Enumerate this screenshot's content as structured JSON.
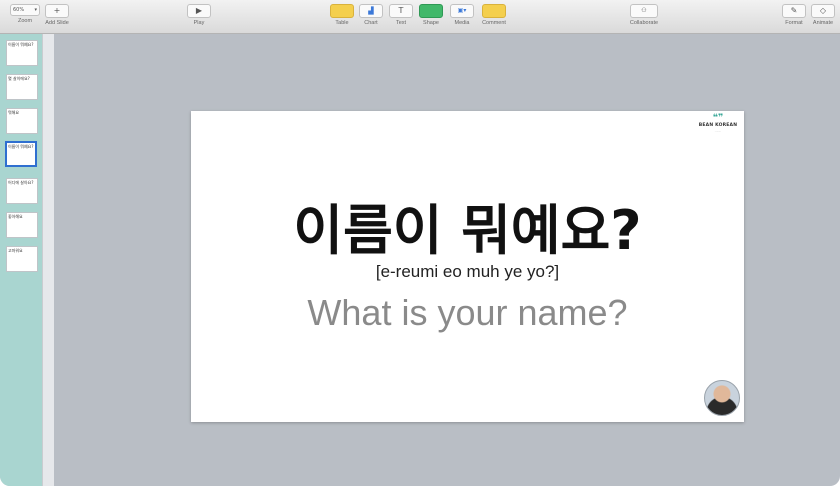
{
  "toolbar": {
    "zoom": {
      "value": "60%",
      "label": "Zoom"
    },
    "add_slide": {
      "label": "Add Slide"
    },
    "play": {
      "label": "Play"
    },
    "table": {
      "label": "Table"
    },
    "chart": {
      "label": "Chart"
    },
    "text": {
      "label": "Text",
      "glyph": "T"
    },
    "shape": {
      "label": "Shape"
    },
    "media": {
      "label": "Media"
    },
    "comment": {
      "label": "Comment"
    },
    "collaborate": {
      "label": "Collaborate"
    },
    "format": {
      "label": "Format"
    },
    "animate": {
      "label": "Animate"
    }
  },
  "navigator": {
    "thumbnails": [
      {
        "text": "이름이 뭐예요?"
      },
      {
        "text": "몇 살이에요?"
      },
      {
        "text": "뭐해요"
      },
      {
        "text": "이름이 뭐예요?",
        "selected": true
      },
      {
        "text": "어디에 살아요?"
      },
      {
        "text": "좋아해요"
      },
      {
        "text": "고마워요"
      }
    ]
  },
  "slide": {
    "logo_name": "BEAN KOREAN",
    "korean": "이름이 뭐예요?",
    "romanization": "[e-reumi eo muh ye yo?]",
    "english": "What is your name?"
  },
  "colors": {
    "accent": "#2f6fd0",
    "navigator_bg": "#a9d5d0",
    "canvas_bg": "#b9bec5",
    "logo": "#3aa898"
  }
}
